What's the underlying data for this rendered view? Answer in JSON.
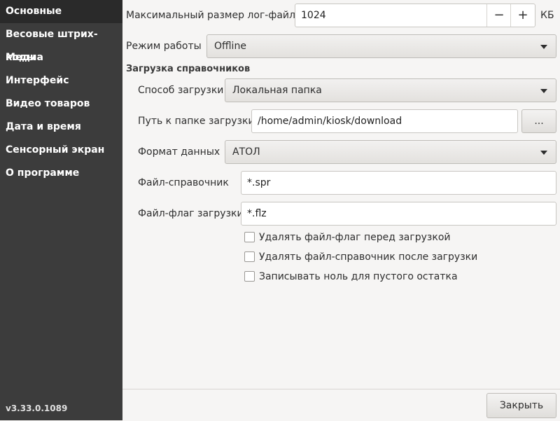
{
  "sidebar": {
    "items": [
      {
        "label": "Основные",
        "active": true
      },
      {
        "label": "Весовые штрих-коды"
      },
      {
        "label": "Медиа"
      },
      {
        "label": "Интерфейс"
      },
      {
        "label": "Видео товаров"
      },
      {
        "label": "Дата и время"
      },
      {
        "label": "Сенсорный экран"
      },
      {
        "label": "О программе"
      }
    ],
    "version": "v3.33.0.1089"
  },
  "settings": {
    "log_size_label": "Максимальный размер лог-файла",
    "log_size_value": "1024",
    "log_size_unit": "КБ",
    "minus_glyph": "−",
    "plus_glyph": "+",
    "mode_label": "Режим работы",
    "mode_value": "Offline",
    "dict_section_title": "Загрузка справочников",
    "load_method_label": "Способ загрузки",
    "load_method_value": "Локальная папка",
    "path_label": "Путь к папке загрузки",
    "path_value": "/home/admin/kiosk/download",
    "browse_label": "...",
    "format_label": "Формат данных",
    "format_value": "АТОЛ",
    "dict_file_label": "Файл-справочник",
    "dict_file_value": "*.spr",
    "flag_file_label": "Файл-флаг загрузки",
    "flag_file_value": "*.flz",
    "checkboxes": [
      {
        "label": "Удалять файл-флаг перед загрузкой",
        "checked": false
      },
      {
        "label": "Удалять файл-справочник после загрузки",
        "checked": false
      },
      {
        "label": "Записывать ноль для пустого остатка",
        "checked": false
      }
    ]
  },
  "footer": {
    "close_label": "Закрыть"
  }
}
